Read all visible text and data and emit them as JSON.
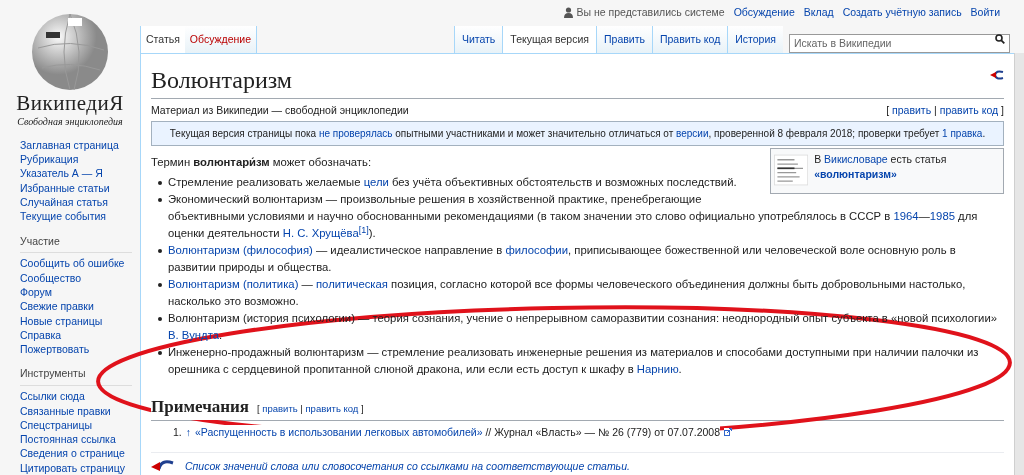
{
  "logo": {
    "wordmark": "ВикипедиЯ",
    "tagline": "Свободная энциклопедия"
  },
  "personal": {
    "status": "Вы не представились системе",
    "links": [
      "Обсуждение",
      "Вклад",
      "Создать учётную запись",
      "Войти"
    ]
  },
  "sidebar": [
    {
      "items": [
        "Заглавная страница",
        "Рубрикация",
        "Указатель А — Я",
        "Избранные статьи",
        "Случайная статья",
        "Текущие события"
      ]
    },
    {
      "heading": "Участие",
      "items": [
        "Сообщить об ошибке",
        "Сообщество",
        "Форум",
        "Свежие правки",
        "Новые страницы",
        "Справка",
        "Пожертвовать"
      ]
    },
    {
      "heading": "Инструменты",
      "items": [
        "Ссылки сюда",
        "Связанные правки",
        "Спецстраницы",
        "Постоянная ссылка",
        "Сведения о странице",
        "Цитировать страницу"
      ]
    }
  ],
  "tabs_left": [
    {
      "label": "Статья",
      "selected": true
    },
    {
      "label": "Обсуждение",
      "selected": false
    }
  ],
  "tabs_right": [
    {
      "label": "Читать",
      "selected": false
    },
    {
      "label": "Текущая версия",
      "selected": true
    },
    {
      "label": "Править",
      "selected": false
    },
    {
      "label": "Править код",
      "selected": false
    },
    {
      "label": "История",
      "selected": false
    }
  ],
  "search": {
    "placeholder": "Искать в Википедии"
  },
  "title": "Волюнтаризм",
  "subtitle": "Материал из Википедии — свободной энциклопедии",
  "edit_links": [
    {
      "kind": "text",
      "text": "[ "
    },
    {
      "kind": "link",
      "text": "править"
    },
    {
      "kind": "text",
      "text": " | "
    },
    {
      "kind": "link",
      "text": "править код"
    },
    {
      "kind": "text",
      "text": " ]"
    }
  ],
  "notice": [
    {
      "kind": "text",
      "text": "Текущая версия страницы пока "
    },
    {
      "kind": "link",
      "text": "не проверялась"
    },
    {
      "kind": "text",
      "text": " опытными участниками и может значительно отличаться от "
    },
    {
      "kind": "link",
      "text": "версии"
    },
    {
      "kind": "text",
      "text": ", проверенной 8 февраля 2018; проверки требует "
    },
    {
      "kind": "link",
      "text": "1 правка"
    },
    {
      "kind": "text",
      "text": "."
    }
  ],
  "intro": [
    {
      "kind": "text",
      "text": "Термин "
    },
    {
      "kind": "bold",
      "text": "волюнтари́зм"
    },
    {
      "kind": "text",
      "text": " может обозначать:"
    }
  ],
  "wiktionary": [
    {
      "kind": "text",
      "text": "В "
    },
    {
      "kind": "link",
      "text": "Викисловаре"
    },
    {
      "kind": "text",
      "text": " есть статья "
    },
    {
      "kind": "boldlink",
      "text": "«волюнтаризм»"
    }
  ],
  "bullets": [
    [
      {
        "kind": "text",
        "text": "Стремление реализовать желаемые "
      },
      {
        "kind": "link",
        "text": "цели"
      },
      {
        "kind": "text",
        "text": " без учёта объективных обстоятельств и возможных последствий."
      }
    ],
    [
      {
        "kind": "text",
        "text": "Экономический волюнтаризм — произвольные решения в хозяйственной практике, пренебрегающие объективными условиями и научно обоснованными рекомендациями (в таком значении это слово официально употреблялось в СССР в "
      },
      {
        "kind": "link",
        "text": "1964"
      },
      {
        "kind": "text",
        "text": "—"
      },
      {
        "kind": "link",
        "text": "1985"
      },
      {
        "kind": "text",
        "text": " для оценки деятельности "
      },
      {
        "kind": "link",
        "text": "Н. С. Хрущёва"
      },
      {
        "kind": "sup",
        "text": "[1]"
      },
      {
        "kind": "text",
        "text": ")."
      }
    ],
    [
      {
        "kind": "link",
        "text": "Волюнтаризм (философия)"
      },
      {
        "kind": "text",
        "text": " — идеалистическое направление в "
      },
      {
        "kind": "link",
        "text": "философии"
      },
      {
        "kind": "text",
        "text": ", приписывающее божественной или человеческой воле основную роль в развитии природы и общества."
      }
    ],
    [
      {
        "kind": "link",
        "text": "Волюнтаризм (политика)"
      },
      {
        "kind": "text",
        "text": " — "
      },
      {
        "kind": "link",
        "text": "политическая"
      },
      {
        "kind": "text",
        "text": " позиция, согласно которой все формы человеческого объединения должны быть добровольными настолько, насколько это возможно."
      }
    ],
    [
      {
        "kind": "text",
        "text": "Волюнтаризм (история психологии) — теория сознания, учение о непрерывном саморазвитии сознания: неоднородный опыт субъекта в «новой психологии» "
      },
      {
        "kind": "link",
        "text": "В. Вундта"
      },
      {
        "kind": "text",
        "text": "."
      }
    ],
    [
      {
        "kind": "text",
        "text": "Инженерно-продажный волюнтаризм — стремление реализовать инженерные решения из материалов и способами доступными при наличии палочки из орешника с сердцевиной пропитанной слюной дракона, или если есть доступ к шкафу в "
      },
      {
        "kind": "link",
        "text": "Нарнию"
      },
      {
        "kind": "text",
        "text": "."
      }
    ]
  ],
  "notes": {
    "heading": "Примечания",
    "edit": [
      {
        "kind": "text",
        "text": "[ "
      },
      {
        "kind": "link",
        "text": "править"
      },
      {
        "kind": "text",
        "text": " | "
      },
      {
        "kind": "link",
        "text": "править код"
      },
      {
        "kind": "text",
        "text": " ]"
      }
    ]
  },
  "references": [
    {
      "number": "1.",
      "arrow": "↑",
      "parts": [
        {
          "kind": "link",
          "text": "«Распущенность в использовании легковых автомобилей»"
        },
        {
          "kind": "text",
          "text": " // Журнал «Власть» — № 26 (779) от 07.07.2008"
        }
      ]
    }
  ],
  "disambig": "Список значений слова или словосочетания со ссылками на соответствующие статьи."
}
